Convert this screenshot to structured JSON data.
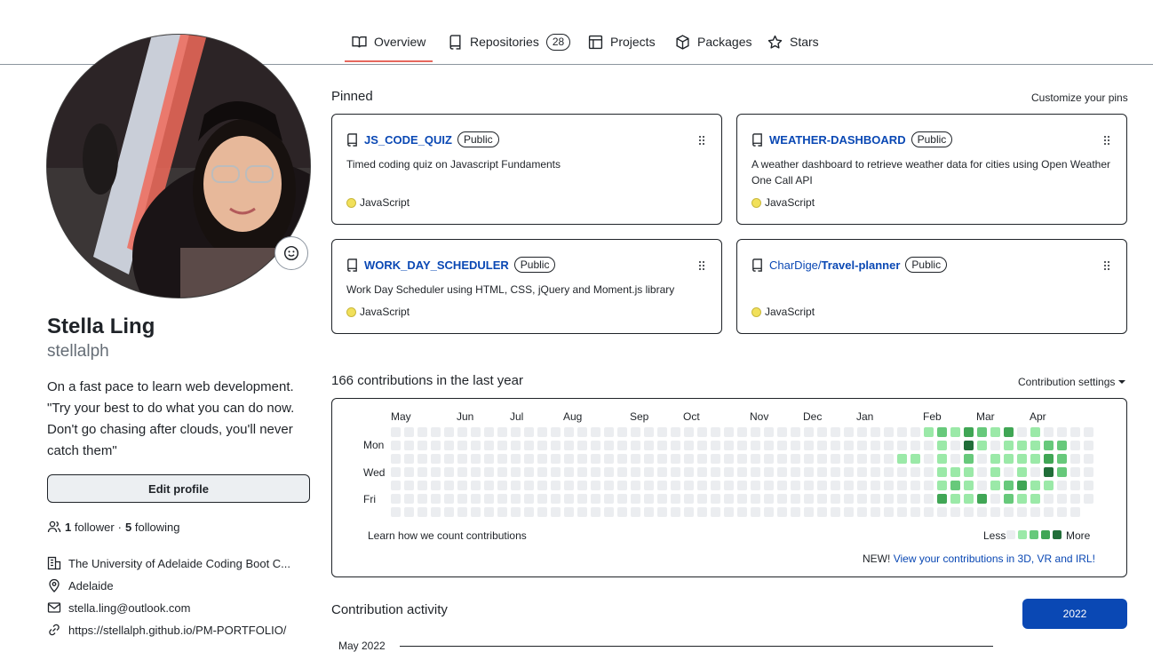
{
  "tabs": [
    {
      "label": "Overview",
      "icon": "book-icon",
      "selected": true
    },
    {
      "label": "Repositories",
      "icon": "repo-icon",
      "count": "28"
    },
    {
      "label": "Projects",
      "icon": "table-icon"
    },
    {
      "label": "Packages",
      "icon": "package-icon"
    },
    {
      "label": "Stars",
      "icon": "star-icon"
    }
  ],
  "profile": {
    "name": "Stella Ling",
    "login": "stellalph",
    "bio": "On a fast pace to learn web development. \"Try your best to do what you can do now. Don't go chasing after clouds, you'll never catch them\"",
    "edit_label": "Edit profile",
    "followers_count": "1",
    "followers_label": "follower",
    "separator": "·",
    "following_count": "5",
    "following_label": "following",
    "organization": "The University of Adelaide Coding Boot C...",
    "location": "Adelaide",
    "email": "stella.ling@outlook.com",
    "website": "https://stellalph.github.io/PM-PORTFOLIO/"
  },
  "pinned": {
    "heading": "Pinned",
    "customize_label": "Customize your pins",
    "items": [
      {
        "owner": "",
        "name": "JS_CODE_QUIZ",
        "visibility": "Public",
        "description": "Timed coding quiz on Javascript Fundaments",
        "language": "JavaScript"
      },
      {
        "owner": "",
        "name": "WEATHER-DASHBOARD",
        "visibility": "Public",
        "description": "A weather dashboard to retrieve weather data for cities using Open Weather One Call API",
        "language": "JavaScript"
      },
      {
        "owner": "",
        "name": "WORK_DAY_SCHEDULER",
        "visibility": "Public",
        "description": "Work Day Scheduler using HTML, CSS, jQuery and Moment.js library",
        "language": "JavaScript"
      },
      {
        "owner": "CharDige/",
        "name": "Travel-planner",
        "visibility": "Public",
        "description": "",
        "language": "JavaScript"
      }
    ],
    "language_color": "#f1e05a"
  },
  "contributions": {
    "heading": "166 contributions in the last year",
    "settings_label": "Contribution settings",
    "months": [
      "May",
      "Jun",
      "Jul",
      "Aug",
      "Sep",
      "Oct",
      "Nov",
      "Dec",
      "Jan",
      "Feb",
      "Mar",
      "Apr"
    ],
    "days": [
      "Mon",
      "Wed",
      "Fri"
    ],
    "learn_label": "Learn how we count contributions",
    "less_label": "Less",
    "more_label": "More",
    "new_label": "NEW!",
    "new_link": "View your contributions in 3D, VR and IRL!",
    "level_colors": [
      "#ebedf0",
      "#9be9a8",
      "#67c97b",
      "#40a655",
      "#216e39"
    ],
    "active_cells": [
      [
        40,
        0,
        1
      ],
      [
        41,
        0,
        2
      ],
      [
        41,
        1,
        1
      ],
      [
        41,
        2,
        1
      ],
      [
        41,
        3,
        1
      ],
      [
        41,
        4,
        1
      ],
      [
        41,
        5,
        3
      ],
      [
        42,
        0,
        1
      ],
      [
        42,
        3,
        1
      ],
      [
        42,
        4,
        2
      ],
      [
        42,
        5,
        1
      ],
      [
        43,
        0,
        3
      ],
      [
        43,
        1,
        4
      ],
      [
        43,
        2,
        2
      ],
      [
        43,
        3,
        1
      ],
      [
        43,
        4,
        1
      ],
      [
        43,
        5,
        1
      ],
      [
        44,
        0,
        2
      ],
      [
        44,
        1,
        1
      ],
      [
        44,
        5,
        3
      ],
      [
        45,
        0,
        1
      ],
      [
        45,
        2,
        1
      ],
      [
        45,
        3,
        1
      ],
      [
        45,
        4,
        1
      ],
      [
        46,
        0,
        3
      ],
      [
        46,
        1,
        1
      ],
      [
        46,
        2,
        1
      ],
      [
        46,
        4,
        2
      ],
      [
        46,
        5,
        2
      ],
      [
        47,
        1,
        1
      ],
      [
        47,
        2,
        1
      ],
      [
        47,
        3,
        1
      ],
      [
        47,
        4,
        3
      ],
      [
        47,
        5,
        1
      ],
      [
        48,
        0,
        1
      ],
      [
        48,
        1,
        1
      ],
      [
        48,
        2,
        1
      ],
      [
        48,
        4,
        1
      ],
      [
        48,
        5,
        1
      ],
      [
        49,
        1,
        2
      ],
      [
        49,
        2,
        3
      ],
      [
        49,
        3,
        4
      ],
      [
        49,
        4,
        1
      ],
      [
        50,
        1,
        2
      ],
      [
        50,
        2,
        2
      ],
      [
        50,
        3,
        2
      ],
      [
        38,
        2,
        1
      ],
      [
        39,
        2,
        1
      ]
    ]
  },
  "activity": {
    "heading": "Contribution activity",
    "year": "2022",
    "month_label": "May 2022"
  }
}
